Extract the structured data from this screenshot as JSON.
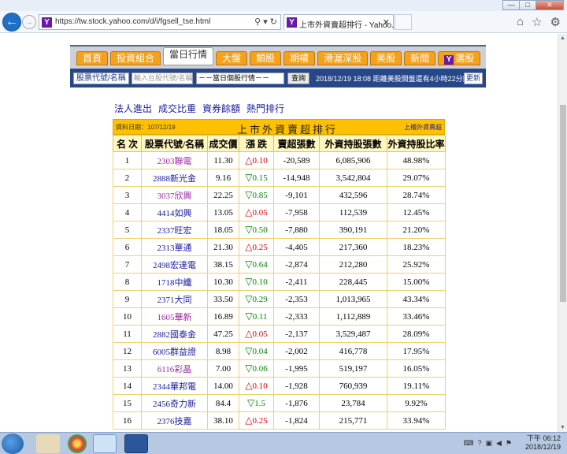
{
  "browser": {
    "url": "https://tw.stock.yahoo.com/d/i/fgsell_tse.html",
    "tab_title": "上市外資賣超排行 - Yahoo...",
    "fav_letter": "Y",
    "window_buttons": {
      "minimize": "—",
      "maximize": "□",
      "close": "✕"
    }
  },
  "ynav": {
    "tabs": [
      {
        "label": "首頁",
        "active": false
      },
      {
        "label": "投資組合",
        "active": false
      },
      {
        "label": "當日行情",
        "active": true
      },
      {
        "label": "大盤",
        "active": false
      },
      {
        "label": "類股",
        "active": false
      },
      {
        "label": "期權",
        "active": false
      },
      {
        "label": "港滬深股",
        "active": false
      },
      {
        "label": "美股",
        "active": false
      },
      {
        "label": "新聞",
        "active": false
      },
      {
        "label": "選股",
        "active": false,
        "badge": "Y"
      }
    ]
  },
  "ybar": {
    "code_select": "股票代號/名稱",
    "input_placeholder": "輸入台股代號/名稱",
    "dropdown": "－－當日個股行情－－",
    "query_button": "查詢",
    "time_text": "2018/12/19 18:08 距離美股開盤還有4小時22分鐘",
    "refresh_button": "更新"
  },
  "sublinks": [
    "法人進出",
    "成交比重",
    "資券餘額",
    "熱門排行"
  ],
  "table": {
    "date": "資料日期：107/12/19",
    "title": "上市外資賣超排行",
    "link": "上櫃外資賣超",
    "headers": [
      "名 次",
      "股票代號/名稱",
      "成交價",
      "漲 跌",
      "賣超張數",
      "外資持股張數",
      "外資持股比率"
    ],
    "rows": [
      {
        "rank": "1",
        "code": "2303",
        "name": "聯電",
        "price": "11.30",
        "dir": "up",
        "change": "0.10",
        "sell": "-20,589",
        "hold": "6,085,906",
        "ratio": "48.98%",
        "visited": true
      },
      {
        "rank": "2",
        "code": "2888",
        "name": "新光金",
        "price": "9.16",
        "dir": "down",
        "change": "0.15",
        "sell": "-14,948",
        "hold": "3,542,804",
        "ratio": "29.07%",
        "visited": false
      },
      {
        "rank": "3",
        "code": "3037",
        "name": "欣興",
        "price": "22.25",
        "dir": "down",
        "change": "0.85",
        "sell": "-9,101",
        "hold": "432,596",
        "ratio": "28.74%",
        "visited": true
      },
      {
        "rank": "4",
        "code": "4414",
        "name": "如興",
        "price": "13.05",
        "dir": "up",
        "change": "0.05",
        "sell": "-7,958",
        "hold": "112,539",
        "ratio": "12.45%",
        "visited": false
      },
      {
        "rank": "5",
        "code": "2337",
        "name": "旺宏",
        "price": "18.05",
        "dir": "down",
        "change": "0.50",
        "sell": "-7,880",
        "hold": "390,191",
        "ratio": "21.20%",
        "visited": false
      },
      {
        "rank": "6",
        "code": "2313",
        "name": "華通",
        "price": "21.30",
        "dir": "up",
        "change": "0.25",
        "sell": "-4,405",
        "hold": "217,360",
        "ratio": "18.23%",
        "visited": false
      },
      {
        "rank": "7",
        "code": "2498",
        "name": "宏達電",
        "price": "38.15",
        "dir": "down",
        "change": "0.64",
        "sell": "-2,874",
        "hold": "212,280",
        "ratio": "25.92%",
        "visited": false
      },
      {
        "rank": "8",
        "code": "1718",
        "name": "中纖",
        "price": "10.30",
        "dir": "down",
        "change": "0.10",
        "sell": "-2,411",
        "hold": "228,445",
        "ratio": "15.00%",
        "visited": false
      },
      {
        "rank": "9",
        "code": "2371",
        "name": "大同",
        "price": "33.50",
        "dir": "down",
        "change": "0.29",
        "sell": "-2,353",
        "hold": "1,013,965",
        "ratio": "43.34%",
        "visited": false
      },
      {
        "rank": "10",
        "code": "1605",
        "name": "華新",
        "price": "16.89",
        "dir": "down",
        "change": "0.11",
        "sell": "-2,333",
        "hold": "1,112,889",
        "ratio": "33.46%",
        "visited": true
      },
      {
        "rank": "11",
        "code": "2882",
        "name": "國泰金",
        "price": "47.25",
        "dir": "up",
        "change": "0.05",
        "sell": "-2,137",
        "hold": "3,529,487",
        "ratio": "28.09%",
        "visited": false
      },
      {
        "rank": "12",
        "code": "6005",
        "name": "群益證",
        "price": "8.98",
        "dir": "down",
        "change": "0.04",
        "sell": "-2,002",
        "hold": "416,778",
        "ratio": "17.95%",
        "visited": false
      },
      {
        "rank": "13",
        "code": "6116",
        "name": "彩晶",
        "price": "7.00",
        "dir": "down",
        "change": "0.06",
        "sell": "-1,995",
        "hold": "519,197",
        "ratio": "16.05%",
        "visited": true
      },
      {
        "rank": "14",
        "code": "2344",
        "name": "華邦電",
        "price": "14.00",
        "dir": "up",
        "change": "0.10",
        "sell": "-1,928",
        "hold": "760,939",
        "ratio": "19.11%",
        "visited": false
      },
      {
        "rank": "15",
        "code": "2456",
        "name": "奇力新",
        "price": "84.4",
        "dir": "down",
        "change": "1.5",
        "sell": "-1,876",
        "hold": "23,784",
        "ratio": "9.92%",
        "visited": false
      },
      {
        "rank": "16",
        "code": "2376",
        "name": "技嘉",
        "price": "38.10",
        "dir": "up",
        "change": "0.25",
        "sell": "-1,824",
        "hold": "215,771",
        "ratio": "33.94%",
        "visited": false
      }
    ]
  },
  "taskbar": {
    "time": "下午 06:12",
    "date": "2018/12/19"
  }
}
